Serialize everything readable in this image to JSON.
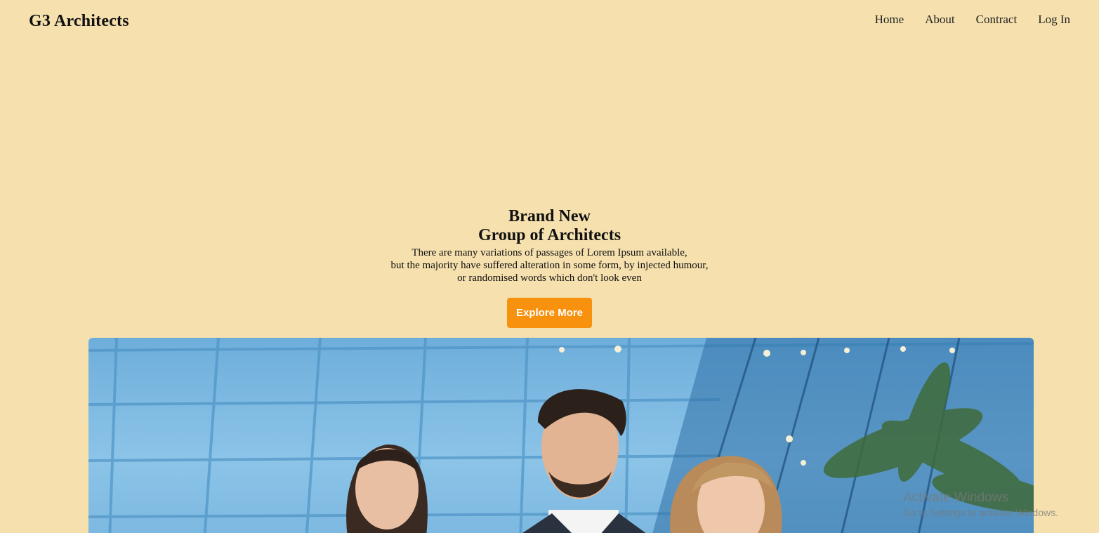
{
  "header": {
    "brand": "G3 Architects",
    "nav": [
      "Home",
      "About",
      "Contract",
      "Log In"
    ]
  },
  "hero": {
    "title_line1": "Brand New",
    "title_line2": "Group of Architects",
    "body_lines": [
      "There are many variations of passages of Lorem Ipsum available,",
      "but the majority have suffered alteration in some form, by injected humour,",
      "or randomised words which don't look even"
    ],
    "cta_label": "Explore More"
  },
  "photo": {
    "description_icon": "team-photo"
  },
  "watermark": {
    "line1": "Activate Windows",
    "line2": "Go to Settings to activate Windows."
  },
  "colors": {
    "background": "#f5e0ae",
    "accent": "#f7910e"
  }
}
